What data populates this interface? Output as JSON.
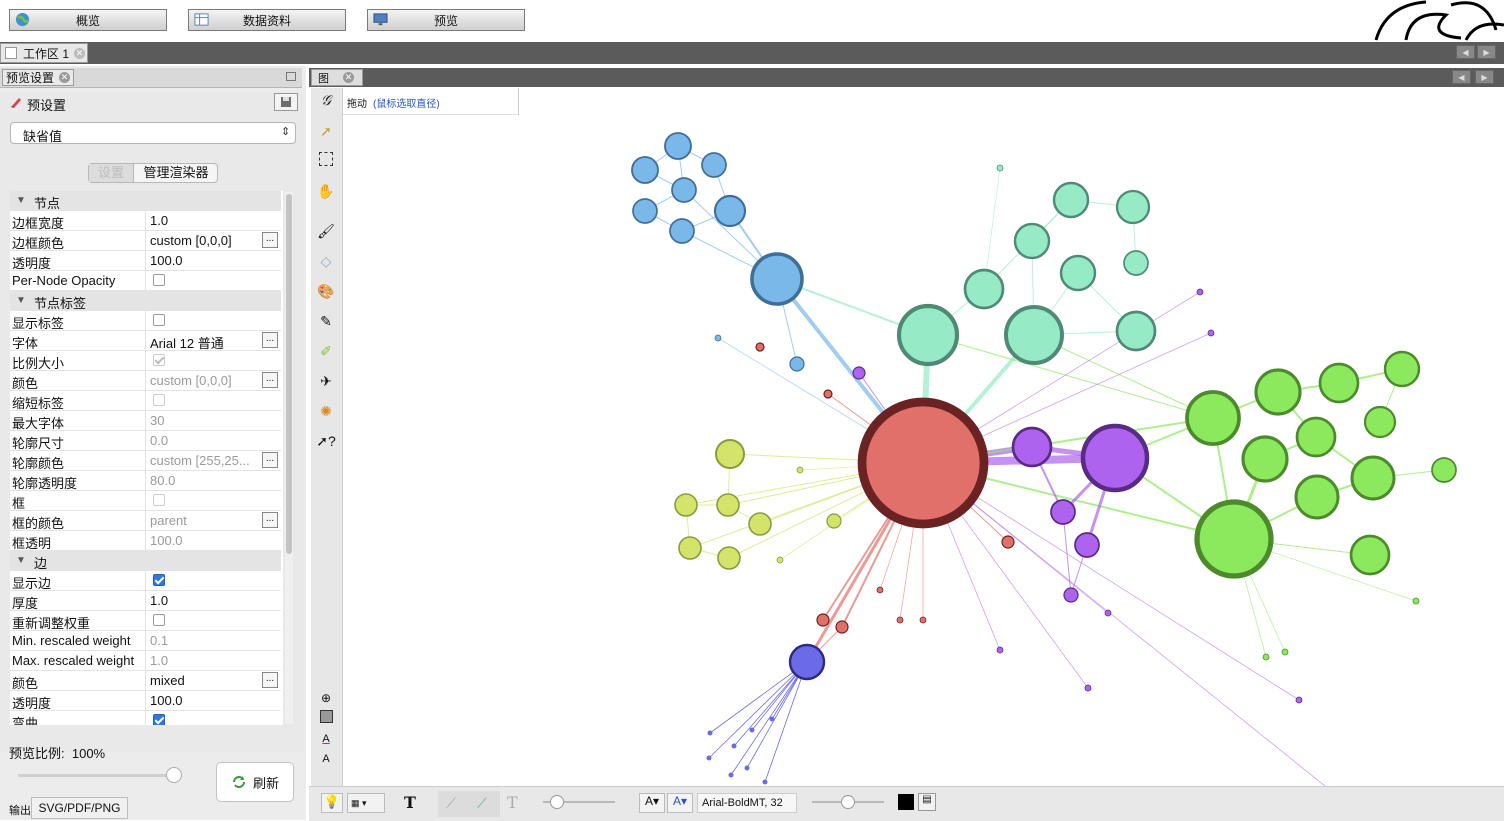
{
  "mode_buttons": [
    {
      "label": "概览",
      "icon": "globe-icon"
    },
    {
      "label": "数据资料",
      "icon": "table-icon"
    },
    {
      "label": "预览",
      "icon": "monitor-icon"
    }
  ],
  "workspace": {
    "tab_label": "工作区 1"
  },
  "left_panel": {
    "tab_label": "预览设置",
    "preset_title": "预设置",
    "preset_value": "缺省值",
    "subtabs": [
      "设置",
      "管理渲染器"
    ],
    "properties": [
      {
        "type": "category",
        "name": "节点"
      },
      {
        "type": "text",
        "name": "边框宽度",
        "value": "1.0"
      },
      {
        "type": "text",
        "name": "边框颜色",
        "value": "custom [0,0,0]",
        "button": true
      },
      {
        "type": "text",
        "name": "透明度",
        "value": "100.0"
      },
      {
        "type": "check",
        "name": "Per-Node Opacity",
        "checked": false
      },
      {
        "type": "category",
        "name": "节点标签"
      },
      {
        "type": "check",
        "name": "显示标签",
        "checked": false
      },
      {
        "type": "text",
        "name": "字体",
        "value": "Arial 12 普通",
        "button": true
      },
      {
        "type": "check",
        "name": "比例大小",
        "checked": true,
        "disabled": true
      },
      {
        "type": "text",
        "name": "颜色",
        "value": "custom [0,0,0]",
        "button": true,
        "disabled": true
      },
      {
        "type": "check",
        "name": "缩短标签",
        "checked": false,
        "disabled": true
      },
      {
        "type": "text",
        "name": "最大字体",
        "value": "30",
        "disabled": true
      },
      {
        "type": "text",
        "name": "轮廓尺寸",
        "value": "0.0",
        "disabled": true
      },
      {
        "type": "text",
        "name": "轮廓颜色",
        "value": "custom [255,25...",
        "button": true,
        "disabled": true
      },
      {
        "type": "text",
        "name": "轮廓透明度",
        "value": "80.0",
        "disabled": true
      },
      {
        "type": "check",
        "name": "框",
        "checked": false,
        "disabled": true
      },
      {
        "type": "text",
        "name": "框的颜色",
        "value": "parent",
        "button": true,
        "disabled": true
      },
      {
        "type": "text",
        "name": "框透明",
        "value": "100.0",
        "disabled": true
      },
      {
        "type": "category",
        "name": "边"
      },
      {
        "type": "check",
        "name": "显示边",
        "checked": true
      },
      {
        "type": "text",
        "name": "厚度",
        "value": "1.0"
      },
      {
        "type": "check",
        "name": "重新调整权重",
        "checked": false
      },
      {
        "type": "text",
        "name": "Min. rescaled weight",
        "value": "0.1",
        "disabled": true
      },
      {
        "type": "text",
        "name": "Max. rescaled weight",
        "value": "1.0",
        "disabled": true
      },
      {
        "type": "text",
        "name": "颜色",
        "value": "mixed",
        "button": true
      },
      {
        "type": "text",
        "name": "透明度",
        "value": "100.0"
      },
      {
        "type": "check",
        "name": "弯曲",
        "checked": true
      }
    ],
    "ratio_label": "预览比例:",
    "ratio_value": "100%",
    "ratio_level": 1.0,
    "refresh_label": "刷新",
    "export_label": "输出",
    "export_button": "SVG/PDF/PNG"
  },
  "graph_panel": {
    "tab_label": "图",
    "drag_label": "拖动",
    "drag_hint": "(鼠标选取直径)"
  },
  "bottom_toolbar": {
    "font_value": "Arial-BoldMT, 32",
    "edge_slider_level": 0.2,
    "label_slider_level": 0.5
  },
  "colors": {
    "blue": "#7ab8ea",
    "teal": "#96ebc6",
    "red": "#e2706a",
    "purple": "#ad63ee",
    "green": "#8ce85c",
    "yellow": "#d4e36a",
    "indigo": "#6b6ae8"
  }
}
